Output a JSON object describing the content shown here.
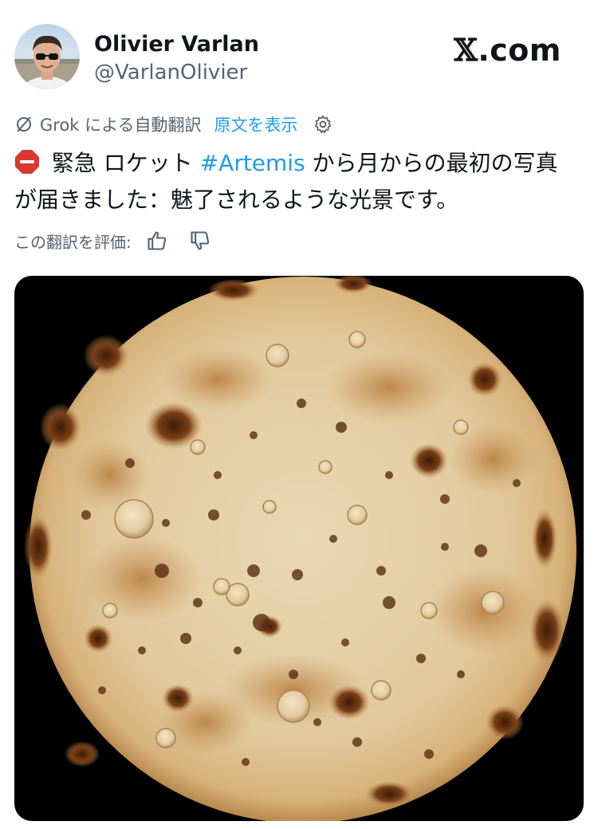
{
  "post": {
    "author": {
      "display_name": "Olivier Varlan",
      "handle": "@VarlanOlivier",
      "avatar_icon": "person-with-sunglasses-avatar"
    },
    "brand": {
      "x_glyph": "𝕏",
      "suffix": ".com"
    },
    "translation": {
      "source_label": "Grok による自動翻訳",
      "show_original_label": "原文を表示",
      "settings_icon": "gear-icon"
    },
    "text": {
      "emoji_icon": "stop-sign-icon",
      "part1": " 緊急 ロケット ",
      "hashtag": "#Artemis",
      "part2": " から月からの最初の写真が届きました：魅了されるような光景です。"
    },
    "rating": {
      "prompt": "この翻訳を評価:",
      "up_icon": "thumbs-up-icon",
      "down_icon": "thumbs-down-icon"
    },
    "media": {
      "description_icon": "tortilla-moon-image"
    }
  },
  "colors": {
    "text": "#0f1419",
    "secondary": "#536471",
    "link": "#1d9bf0",
    "media_bg": "#000000",
    "tortilla": "#e4cfa5",
    "char": "#5a2e12"
  }
}
